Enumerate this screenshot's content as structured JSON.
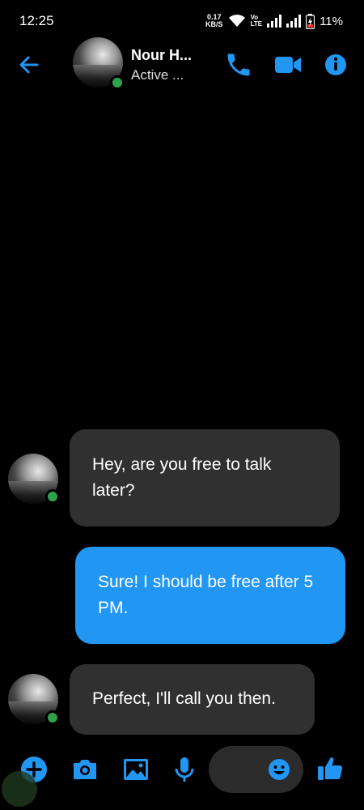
{
  "status_bar": {
    "time": "12:25",
    "net_speed_value": "0.17",
    "net_speed_unit": "KB/S",
    "volte_top": "Vo",
    "volte_bottom": "LTE",
    "battery": "11%"
  },
  "header": {
    "contact_name": "Nour H...",
    "contact_status": "Active ..."
  },
  "messages": [
    {
      "direction": "incoming",
      "text": "Hey, are you free to talk later?"
    },
    {
      "direction": "outgoing",
      "text": "Sure! I should be free after 5 PM."
    },
    {
      "direction": "incoming",
      "text": "Perfect, I'll call you then."
    }
  ],
  "colors": {
    "accent": "#2196f3",
    "incoming_bubble": "#303030",
    "online": "#31a24c",
    "background": "#000000"
  },
  "icons": {
    "back": "arrow-left-icon",
    "call": "phone-icon",
    "video": "video-camera-icon",
    "info": "info-icon",
    "add": "plus-circle-icon",
    "camera": "camera-icon",
    "gallery": "image-icon",
    "voice": "microphone-icon",
    "emoji": "emoji-icon",
    "like": "thumbs-up-icon"
  }
}
